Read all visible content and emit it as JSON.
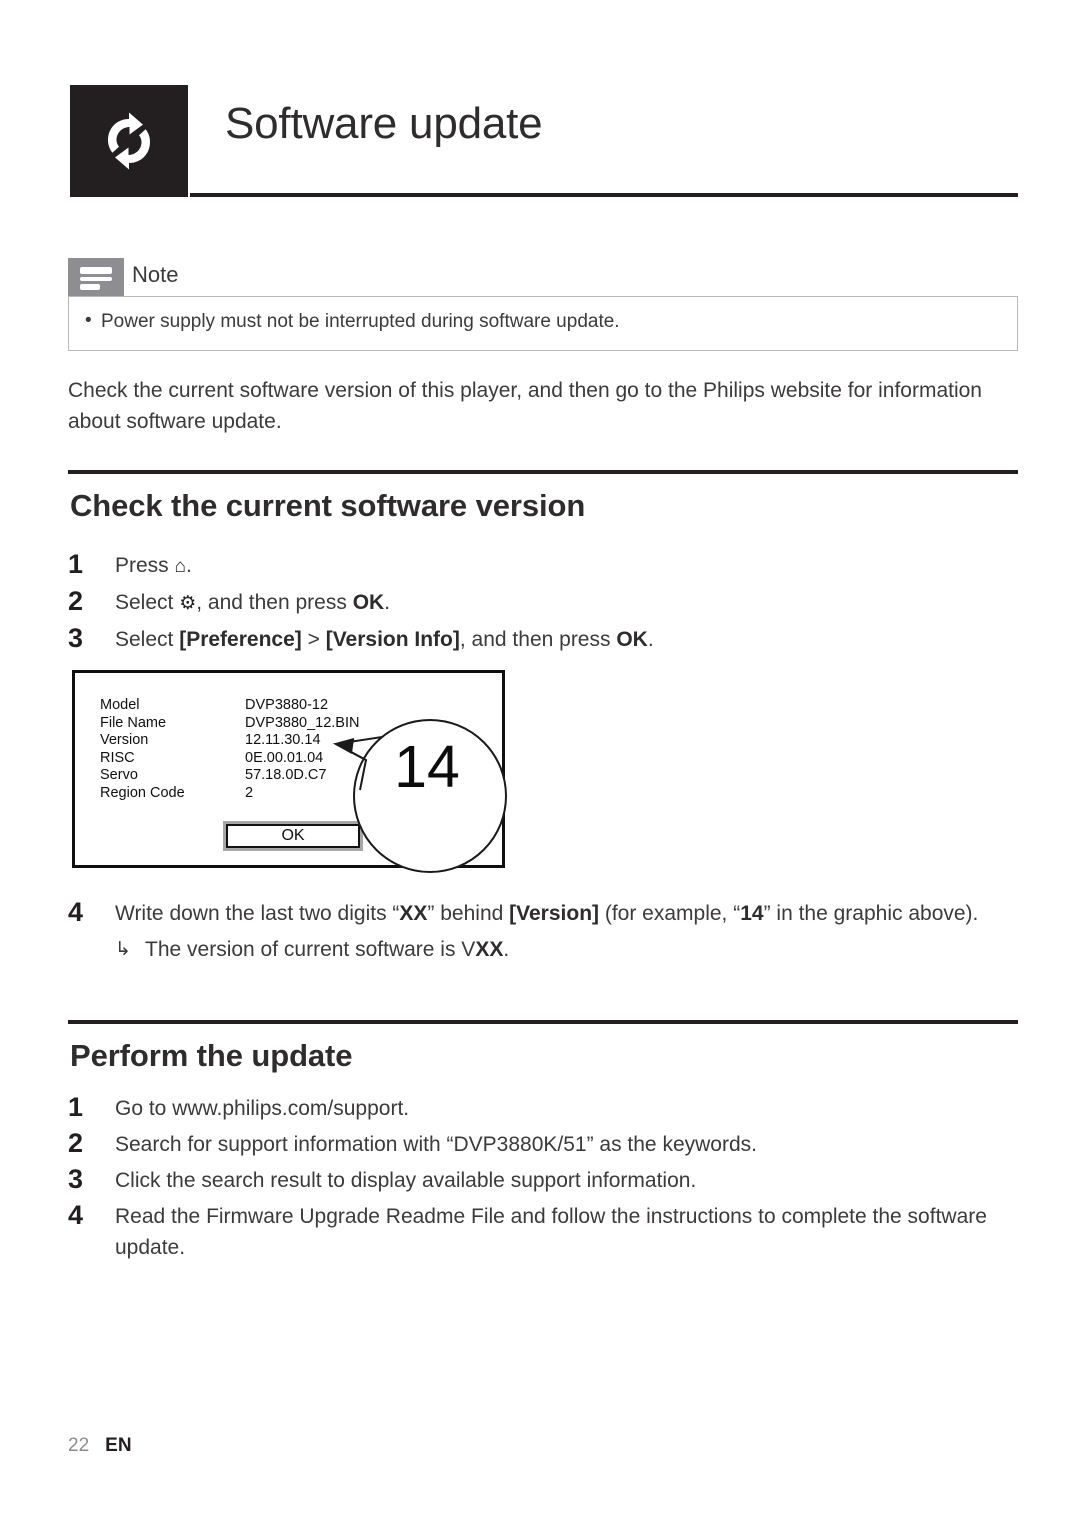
{
  "chapter": {
    "title": "Software update",
    "icon": "software-update-arrows-icon"
  },
  "note": {
    "label": "Note",
    "icon": "note-lines-icon",
    "bullet_glyph": "•",
    "items": [
      "Power supply must not be interrupted during software update."
    ]
  },
  "intro": "Check the current software version of this player, and then go to the Philips website for information about software update.",
  "sections": [
    {
      "title": "Check the current software version",
      "steps": [
        {
          "num": "1",
          "parts": [
            {
              "text": "Press ",
              "style": "normal"
            },
            {
              "text": "⌂",
              "style": "icon",
              "icon": "home-icon"
            },
            {
              "text": ".",
              "style": "normal"
            }
          ]
        },
        {
          "num": "2",
          "parts": [
            {
              "text": "Select ",
              "style": "normal"
            },
            {
              "text": "⚙",
              "style": "icon",
              "icon": "settings-gear-icon"
            },
            {
              "text": ", and then press ",
              "style": "normal"
            },
            {
              "text": "OK",
              "style": "bold"
            },
            {
              "text": ".",
              "style": "normal"
            }
          ]
        },
        {
          "num": "3",
          "parts": [
            {
              "text": "Select ",
              "style": "normal"
            },
            {
              "text": "[Preference]",
              "style": "bold"
            },
            {
              "text": " > ",
              "style": "normal"
            },
            {
              "text": "[Version Info]",
              "style": "bold"
            },
            {
              "text": ", and then press ",
              "style": "normal"
            },
            {
              "text": "OK",
              "style": "bold"
            },
            {
              "text": ".",
              "style": "normal"
            }
          ]
        },
        {
          "num": "4",
          "parts": [
            {
              "text": "Write down the last two digits “",
              "style": "normal"
            },
            {
              "text": "XX",
              "style": "bold"
            },
            {
              "text": "” behind ",
              "style": "normal"
            },
            {
              "text": "[Version]",
              "style": "bold"
            },
            {
              "text": " (for example, “",
              "style": "normal"
            },
            {
              "text": "14",
              "style": "bold"
            },
            {
              "text": "” in the graphic above).",
              "style": "normal"
            }
          ],
          "substep": {
            "arrow": "↳",
            "parts": [
              {
                "text": "The version of current software is V",
                "style": "normal"
              },
              {
                "text": "XX",
                "style": "bold"
              },
              {
                "text": ".",
                "style": "normal"
              }
            ]
          }
        }
      ]
    },
    {
      "title": "Perform the update",
      "steps": [
        {
          "num": "1",
          "parts": [
            {
              "text": "Go to www.philips.com/support.",
              "style": "normal"
            }
          ]
        },
        {
          "num": "2",
          "parts": [
            {
              "text": "Search for support information with “DVP3880K/51” as the keywords.",
              "style": "normal"
            }
          ]
        },
        {
          "num": "3",
          "parts": [
            {
              "text": "Click the search result to display available support information.",
              "style": "normal"
            }
          ]
        },
        {
          "num": "4",
          "parts": [
            {
              "text": "Read the Firmware Upgrade Readme File and follow the instructions to complete the software update.",
              "style": "normal"
            }
          ]
        }
      ]
    }
  ],
  "version_dialog": {
    "rows": [
      {
        "key": "Model",
        "value": "DVP3880-12"
      },
      {
        "key": "File Name",
        "value": "DVP3880_12.BIN"
      },
      {
        "key": "Version",
        "value": "12.11.30.14"
      },
      {
        "key": "RISC",
        "value": "0E.00.01.04"
      },
      {
        "key": "Servo",
        "value": "57.18.0D.C7"
      },
      {
        "key": "Region Code",
        "value": "2"
      }
    ],
    "ok_label": "OK",
    "callout_value": "14"
  },
  "footer": {
    "page_number": "22",
    "language": "EN"
  },
  "colors": {
    "ink": "#3c3a3b",
    "heading": "#2f2c2d",
    "rule": "#231f20",
    "note_tab": "#8d8d92",
    "note_border": "#b9b9bd",
    "page_number": "#8b8b90"
  }
}
